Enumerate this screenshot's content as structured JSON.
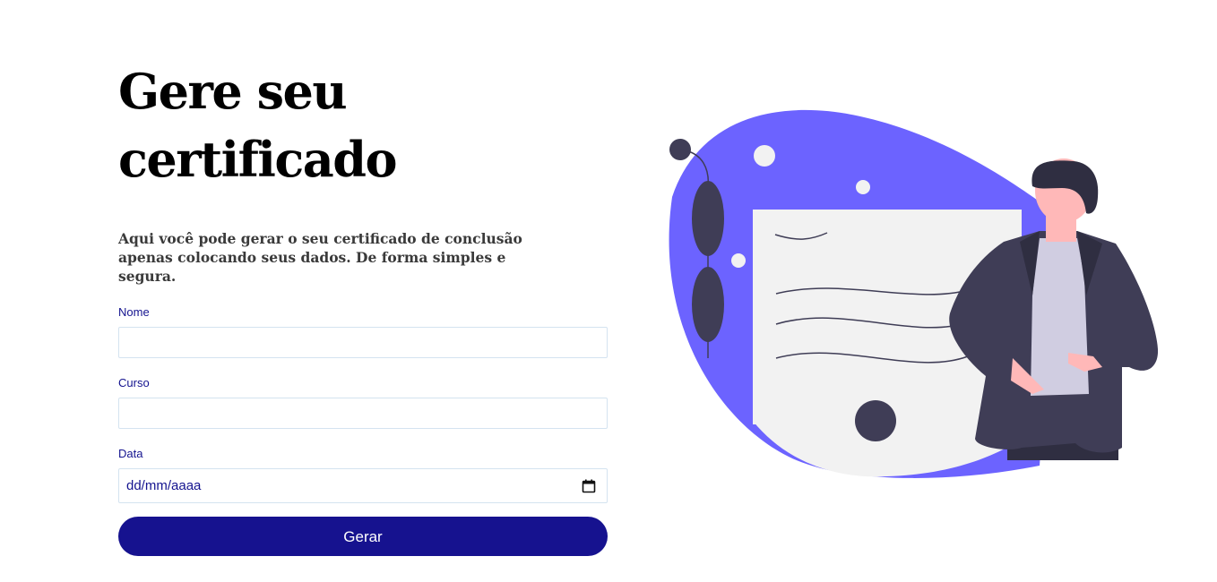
{
  "header": {
    "title": "Gere seu certificado",
    "description": "Aqui você pode gerar o seu certificado de conclusão apenas colocando seus dados. De forma simples e segura."
  },
  "form": {
    "name_label": "Nome",
    "course_label": "Curso",
    "date_label": "Data",
    "date_placeholder": "dd/mm/aaaa",
    "submit_label": "Gerar"
  },
  "colors": {
    "accent": "#6c63ff",
    "button": "#16128f",
    "label": "#14138f"
  },
  "icons": {
    "date_picker": "calendar-icon"
  }
}
